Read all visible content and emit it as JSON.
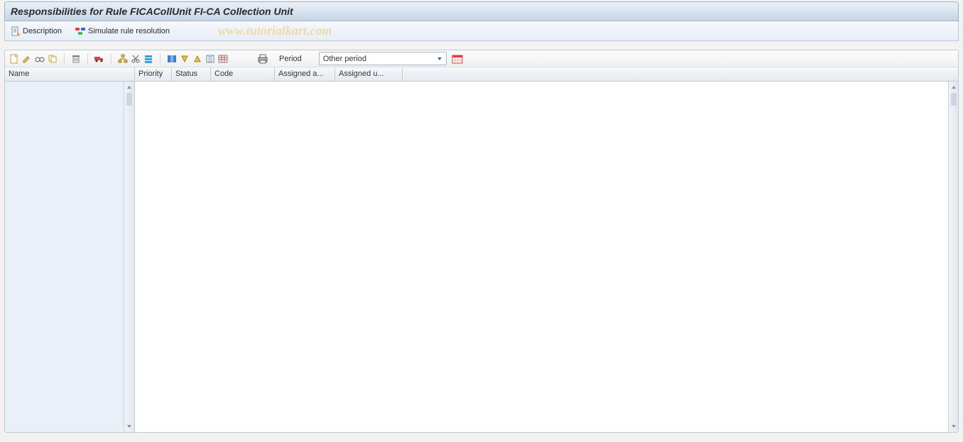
{
  "titlebar": {
    "title": "Responsibilities for Rule FICACollUnit FI-CA Collection Unit"
  },
  "app_toolbar": {
    "description_label": "Description",
    "simulate_label": "Simulate rule resolution",
    "watermark": "www.tutorialkart.com"
  },
  "grid_toolbar": {
    "icons": {
      "create": "create-icon",
      "change": "change-icon",
      "display": "display-icon",
      "copy": "copy-icon",
      "delete": "delete-icon",
      "transport": "transport-icon",
      "hierarchy": "hierarchy-icon",
      "cut": "cut-icon",
      "expand": "expand-icon",
      "collapse": "collapse-icon",
      "columns": "columns-icon",
      "sort_desc": "sort-desc-icon",
      "sort_asc": "sort-asc-icon",
      "filter": "filter-icon",
      "layout": "layout-icon",
      "print": "print-icon",
      "period_picker": "period-picker-icon"
    },
    "period_label": "Period",
    "period_value": "Other period"
  },
  "table": {
    "columns": {
      "name": "Name",
      "priority": "Priority",
      "status": "Status",
      "code": "Code",
      "assigned_a": "Assigned a...",
      "assigned_u": "Assigned u..."
    },
    "rows": []
  }
}
